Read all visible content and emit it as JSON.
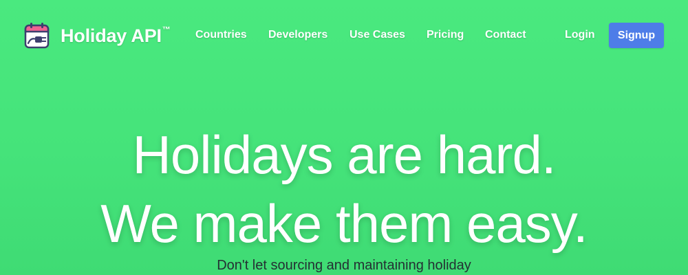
{
  "brand": {
    "name": "Holiday API",
    "trademark": "™",
    "icon": "calendar-plug-icon"
  },
  "nav": {
    "links": [
      "Countries",
      "Developers",
      "Use Cases",
      "Pricing",
      "Contact"
    ],
    "login": "Login",
    "signup": "Signup"
  },
  "hero": {
    "line1": "Holidays are hard.",
    "line2": "We make them easy.",
    "subtitle": "Don't let sourcing and maintaining holiday"
  },
  "colors": {
    "background": "#46e57b",
    "signup_button": "#4e7de8",
    "subtitle_text": "#243033"
  }
}
